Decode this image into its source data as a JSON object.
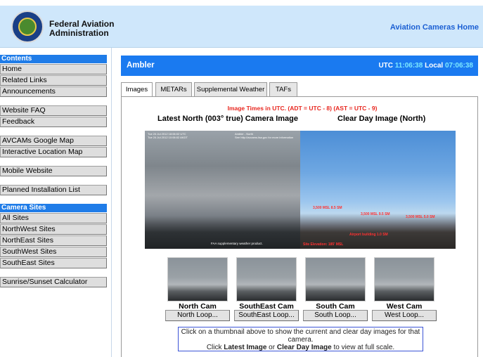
{
  "header": {
    "agency_line1": "Federal Aviation",
    "agency_line2": "Administration",
    "home_link": "Aviation Cameras Home"
  },
  "sidebar": {
    "contents_heading": "Contents",
    "group1": [
      "Home",
      "Related Links",
      "Announcements"
    ],
    "group2": [
      "Website FAQ",
      "Feedback"
    ],
    "group3": [
      "AVCAMs Google Map",
      "Interactive Location Map"
    ],
    "group4": [
      "Mobile Website"
    ],
    "group5": [
      "Planned Installation List"
    ],
    "camera_sites_heading": "Camera Sites",
    "camera_sites": [
      "All Sites",
      "NorthWest Sites",
      "NorthEast Sites",
      "SouthWest Sites",
      "SouthEast Sites"
    ],
    "group6": [
      "Sunrise/Sunset Calculator"
    ]
  },
  "site": {
    "name": "Ambler",
    "utc_label": "UTC",
    "utc_time": "11:06:38",
    "local_label": "Local",
    "local_time": "07:06:38"
  },
  "tabs": [
    "Images",
    "METARs",
    "Supplemental Weather",
    "TAFs"
  ],
  "active_tab": "Images",
  "images": {
    "note": "Image Times in UTC. (ADT = UTC - 8) (AST = UTC - 9)",
    "latest_caption": "Latest North (003° true) Camera Image",
    "clear_caption": "Clear Day Image (North)",
    "overlay_line1": "Tue 24 Jul 2012 18:06:02 UTC",
    "overlay_line2": "Tue 24 Jul 2012 10:06:02 AKDT",
    "overlay_site": "Ambler - North",
    "overlay_note": "See http://avcams.faa.gov for more information",
    "overlay_bottom": "FAA supplementary weather product.",
    "clear_labels": [
      "3,500 MSL 8.5 SM",
      "3,500 MSL 9.5 SM",
      "3,500 MSL 5.0 SM",
      "Airport building 1.0 SM",
      "Site Elevation: 185' MSL"
    ]
  },
  "cams": [
    {
      "name": "North Cam",
      "loop": "North Loop..."
    },
    {
      "name": "SouthEast Cam",
      "loop": "SouthEast Loop..."
    },
    {
      "name": "South Cam",
      "loop": "South Loop..."
    },
    {
      "name": "West Cam",
      "loop": "West Loop..."
    }
  ],
  "instructions": {
    "line1": "Click on a thumbnail above to show the current and clear day images for that camera.",
    "line2_pre": "Click ",
    "line2_latest": "Latest Image",
    "line2_mid": " or ",
    "line2_clear": "Clear Day Image",
    "line2_post": " to view at full scale."
  },
  "colors": {
    "accent_blue": "#1a7af0",
    "header_bg": "#cfe7fb",
    "note_red": "#e8261e",
    "time_cyan": "#7de9ff"
  }
}
